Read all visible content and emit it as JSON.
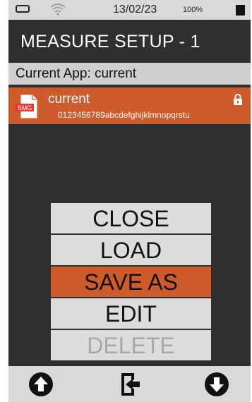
{
  "status_bar": {
    "date": "13/02/23",
    "battery_percent": "100%",
    "icons": [
      "battery-icon",
      "wifi-icon",
      "status-square-icon"
    ]
  },
  "title": "MEASURE SETUP - 1",
  "current_app": "Current App:  current",
  "file": {
    "name": "current",
    "description": "0123456789abcdefghijklmnopqrstu",
    "icon_label": "SMG",
    "locked": true
  },
  "menu": {
    "items": [
      {
        "label": "CLOSE",
        "state": "normal"
      },
      {
        "label": "LOAD",
        "state": "normal"
      },
      {
        "label": "SAVE AS",
        "state": "selected"
      },
      {
        "label": "EDIT",
        "state": "normal"
      },
      {
        "label": "DELETE",
        "state": "disabled"
      }
    ]
  },
  "bottom_bar": {
    "icons": [
      "arrow-up-icon",
      "exit-icon",
      "arrow-down-icon"
    ]
  },
  "colors": {
    "accent": "#cd5b2b",
    "background": "#2f2f2f",
    "bars": "#d9d9d9"
  }
}
